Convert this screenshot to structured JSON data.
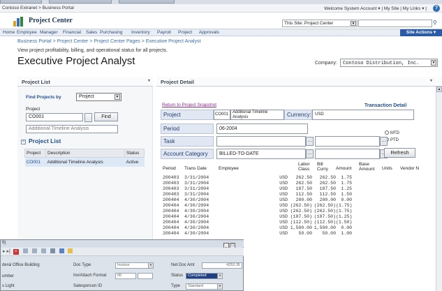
{
  "chrome": {
    "breadcrumb": "Contoso Extranet > Business Portal",
    "welcome": "Welcome System Account ▾ | My Site | My Links ▾ |"
  },
  "site": {
    "title": "Project Center",
    "this_site": "This Site: Project Center",
    "site_actions": "Site Actions ▾"
  },
  "nav": [
    "Home",
    "Employee",
    "Manager",
    "Financial",
    "Sales",
    "Purchasing",
    "Inventory",
    "Payroll",
    "Project",
    "Approvals"
  ],
  "page": {
    "breadcrumb": "Business Portal > Project Center > Project Center Pages > Executive Project Analyst",
    "description": "View project profitability, billing, and operational status for all projects.",
    "title": "Executive Project Analyst",
    "company_label": "Company:",
    "company": "Contoso Distribution, Inc."
  },
  "project_list_panel": {
    "header": "Project List",
    "find_by_label": "Find Projects by",
    "find_by_value": "Project",
    "project_label": "Project",
    "project_value": "CO001",
    "find_button": "Find",
    "description_value": "Additional Timeline Analysis",
    "list_title": "Project List",
    "columns": [
      "Project",
      "Description",
      "Status"
    ],
    "rows": [
      {
        "project": "CO001",
        "description": "Additional Timeline Analysis",
        "status": "Active"
      }
    ]
  },
  "project_detail": {
    "header": "Project Detail",
    "return_link": "Return to Project Snapshot",
    "transaction_detail": "Transaction Detail",
    "project_label": "Project",
    "project_code": "CO001",
    "project_desc": "Additional Timeline Analysis",
    "currency_label": "Currency:",
    "currency": "USD",
    "period_label": "Period",
    "period": "06-2004",
    "task_label": "Task",
    "account_category_label": "Account Category",
    "account_category": "BILLED-TO-DATE",
    "mtd": "MTD",
    "ptd": "PTD",
    "refresh": "Refresh",
    "columns": {
      "period": "Period",
      "trans_date": "Trans Date",
      "employee": "Employee",
      "labor_class_1": "Labor",
      "labor_class_2": "Class",
      "bill_curry_1": "Bill",
      "bill_curry_2": "Curry",
      "amount": "Amount",
      "base_amount_1": "Base",
      "base_amount_2": "Amount",
      "units": "Units",
      "vendor": "Vendor N"
    },
    "rows": [
      {
        "period": "200403",
        "date": "3/31/2004",
        "curry": "USD",
        "amount": "262.50",
        "base": "262.50",
        "units": "1.75"
      },
      {
        "period": "200403",
        "date": "3/31/2004",
        "curry": "USD",
        "amount": "262.50",
        "base": "262.50",
        "units": "1.75"
      },
      {
        "period": "200403",
        "date": "3/31/2004",
        "curry": "USD",
        "amount": "187.50",
        "base": "187.50",
        "units": "1.25"
      },
      {
        "period": "200403",
        "date": "3/31/2004",
        "curry": "USD",
        "amount": "112.50",
        "base": "112.50",
        "units": "1.50"
      },
      {
        "period": "200404",
        "date": "4/30/2004",
        "curry": "USD",
        "amount": "200.00",
        "base": "200.00",
        "units": "0.00"
      },
      {
        "period": "200404",
        "date": "4/30/2004",
        "curry": "USD",
        "amount": "(262.50)",
        "base": "(262.50)",
        "units": "(1.75)"
      },
      {
        "period": "200404",
        "date": "4/30/2004",
        "curry": "USD",
        "amount": "(262.50)",
        "base": "(262.50)",
        "units": "(1.75)"
      },
      {
        "period": "200404",
        "date": "4/30/2004",
        "curry": "USD",
        "amount": "(187.50)",
        "base": "(187.50)",
        "units": "(1.25)"
      },
      {
        "period": "200404",
        "date": "4/30/2004",
        "curry": "USD",
        "amount": "(112.50)",
        "base": "(112.50)",
        "units": "(1.50)"
      },
      {
        "period": "200404",
        "date": "4/30/2004",
        "curry": "USD",
        "amount": "1,500.00",
        "base": "1,500.00",
        "units": "0.00"
      },
      {
        "period": "200404",
        "date": "4/30/2004",
        "curry": "USD",
        "amount": "50.00",
        "base": "50.00",
        "units": "1.00"
      }
    ]
  },
  "gp_window": {
    "title": "0)",
    "fields": {
      "building": "deral Office Building",
      "number": "umber",
      "light": "s Light",
      "doc_type_label": "Doc Type",
      "doc_type": "Invoice",
      "inv_attach_label": "Inv/Attach Format",
      "inv_attach": "06",
      "salesperson_label": "Salesperson ID",
      "net_doc_amt_label": "Net Doc Amt",
      "net_doc_amt": "4253.35",
      "status_label": "Status",
      "status": "Completed",
      "type_label": "Type",
      "type": "Standard"
    }
  }
}
